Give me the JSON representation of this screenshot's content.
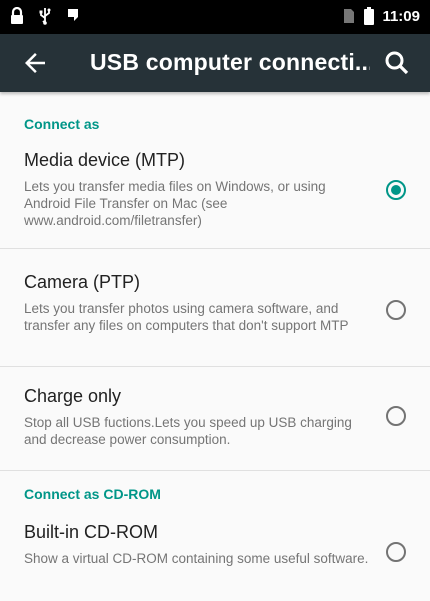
{
  "status_bar": {
    "time": "11:09",
    "icons_left": [
      "lock-icon",
      "usb-icon",
      "notification-icon"
    ],
    "icons_right": [
      "no-sim-icon",
      "battery-icon"
    ]
  },
  "toolbar": {
    "title": "USB computer connecti...",
    "back_icon": "arrow-back-icon",
    "search_icon": "search-icon"
  },
  "sections": {
    "connect_as": "Connect as",
    "connect_as_cdrom": "Connect as CD-ROM"
  },
  "options": [
    {
      "title": "Media device (MTP)",
      "summary": "Lets you transfer media files on Windows, or using Android File Transfer on Mac (see www.android.com/filetransfer)",
      "selected": true
    },
    {
      "title": "Camera (PTP)",
      "summary": "Lets you transfer photos using camera software, and transfer any files on computers that don't support MTP",
      "selected": false
    },
    {
      "title": "Charge only",
      "summary": "Stop all USB fuctions.Lets you speed up USB charging and decrease power consumption.",
      "selected": false
    },
    {
      "title": "Built-in CD-ROM",
      "summary": "Show a virtual CD-ROM containing some useful software.",
      "selected": false
    }
  ],
  "colors": {
    "accent": "#009688",
    "toolbar": "#263238",
    "status_bar": "#000000"
  }
}
